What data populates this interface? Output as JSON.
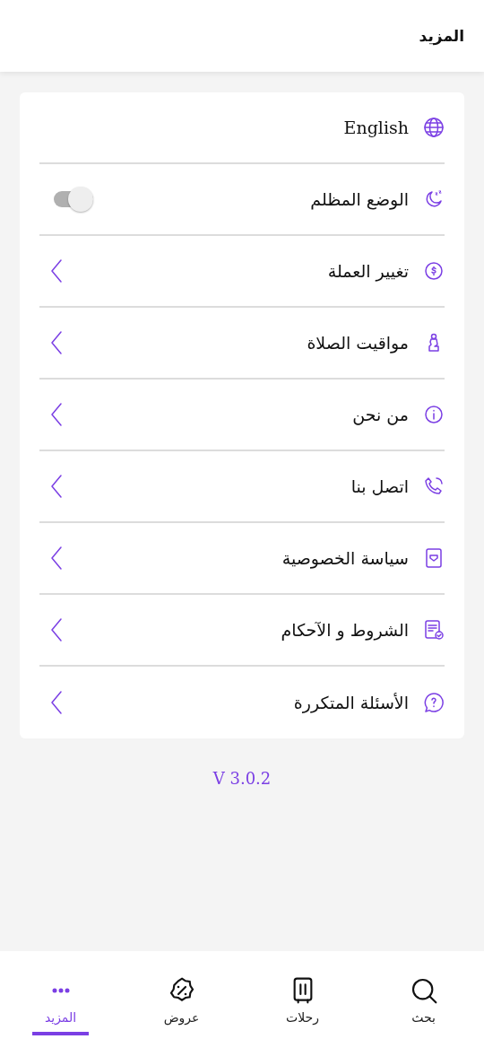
{
  "header": {
    "title": "المزيد"
  },
  "items": [
    {
      "kind": "link",
      "label": "English"
    },
    {
      "kind": "toggle",
      "label": "الوضع المظلم",
      "on": false
    },
    {
      "kind": "nav",
      "label": "تغيير العملة"
    },
    {
      "kind": "nav",
      "label": "مواقيت الصلاة"
    },
    {
      "kind": "nav",
      "label": "من نحن"
    },
    {
      "kind": "nav",
      "label": "اتصل بنا"
    },
    {
      "kind": "nav",
      "label": "سياسة الخصوصية"
    },
    {
      "kind": "nav",
      "label": "الشروط و الآحكام"
    },
    {
      "kind": "nav",
      "label": "الأسئلة المتكررة"
    }
  ],
  "version": "V 3.0.2",
  "tabs": [
    {
      "label": "بحث",
      "selected": false
    },
    {
      "label": "رحلات",
      "selected": false
    },
    {
      "label": "عروض",
      "selected": false
    },
    {
      "label": "المزيد",
      "selected": true
    }
  ]
}
